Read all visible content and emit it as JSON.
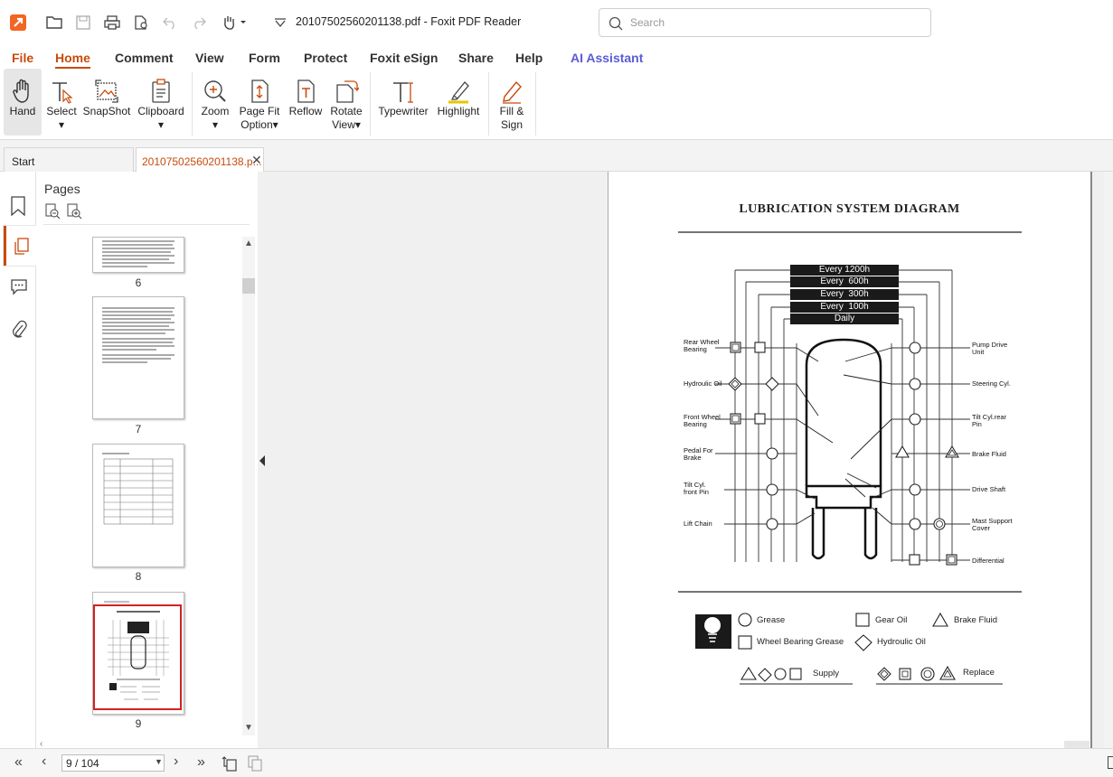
{
  "window": {
    "title": "20107502560201138.pdf - Foxit PDF Reader",
    "search_placeholder": "Search"
  },
  "menu": [
    "File",
    "Home",
    "Comment",
    "View",
    "Form",
    "Protect",
    "Foxit eSign",
    "Share",
    "Help",
    "AI Assistant"
  ],
  "ribbon": {
    "hand": "Hand",
    "select": "Select",
    "snapshot": "SnapShot",
    "clipboard": "Clipboard",
    "zoom": "Zoom",
    "pagefit_1": "Page Fit",
    "pagefit_2": "Option",
    "reflow": "Reflow",
    "rotate_1": "Rotate",
    "rotate_2": "View",
    "typewriter": "Typewriter",
    "highlight": "Highlight",
    "fillsign_1": "Fill &",
    "fillsign_2": "Sign"
  },
  "tabs": {
    "start": "Start",
    "doc": "20107502560201138.p..."
  },
  "pages_panel": {
    "title": "Pages",
    "thumbs": [
      "6",
      "7",
      "8",
      "9"
    ]
  },
  "document": {
    "heading": "LUBRICATION SYSTEM DIAGRAM",
    "intervals": [
      "Every 1200h",
      "Every  600h",
      "Every  300h",
      "Every  100h",
      "Daily"
    ],
    "left_labels": [
      "Rear Wheel\nBearing",
      "Hydroulic Oil",
      "Front Wheel\nBearing",
      "Pedal For\nBrake",
      "Tilt Cyl.\nfront Pin",
      "Lift Chain"
    ],
    "right_labels": [
      "Pump Drive\nUnit",
      "Steering Cyl.",
      "Tilt Cyl.rear\nPin",
      "Brake Fluid",
      "Drive Shaft",
      "Mast Support\nCover",
      "Differential"
    ],
    "legend": {
      "grease": "Grease",
      "gear_oil": "Gear Oil",
      "brake_fluid": "Brake Fluid",
      "wheel_bearing_grease": "Wheel Bearing Grease",
      "hydraulic_oil": "Hydroulic Oil",
      "supply": "Supply",
      "replace": "Replace"
    }
  },
  "statusbar": {
    "page_field": "9 / 104"
  },
  "colors": {
    "accent": "#c84b0c",
    "ai": "#5b5bd6",
    "selected_thumb_border": "#d32222"
  }
}
